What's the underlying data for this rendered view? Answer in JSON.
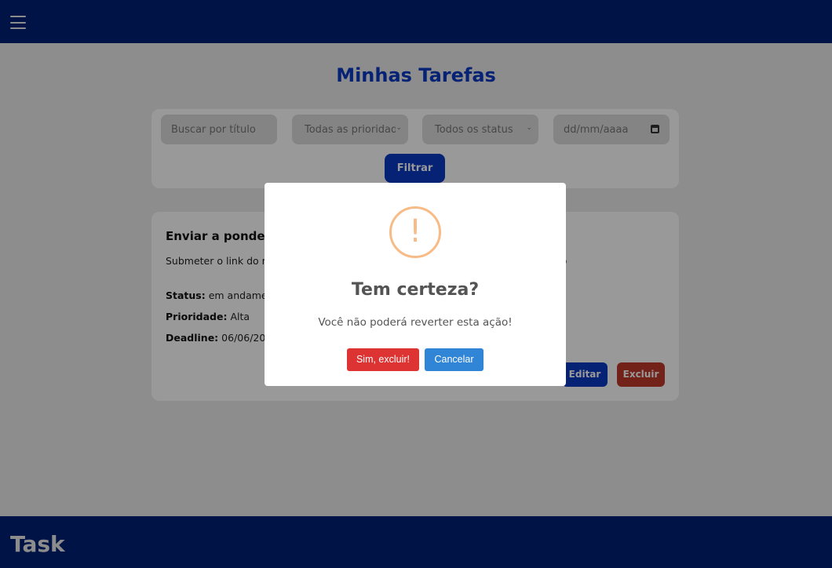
{
  "header": {
    "menu_icon": "hamburger-menu-icon"
  },
  "page": {
    "title": "Minhas Tarefas"
  },
  "filters": {
    "search_placeholder": "Buscar por título",
    "priority_selected": "Todas as prioridades",
    "status_selected": "Todos os status",
    "date_placeholder": "dd/mm/aaaa",
    "filter_button": "Filtrar"
  },
  "task": {
    "title": "Enviar a ponderação",
    "description": "Submeter o link do repositório do GitHub. Lembrar de deixar o repositório público",
    "status_label": "Status:",
    "status_value": "em andamento",
    "priority_label": "Prioridade:",
    "priority_value": "Alta",
    "deadline_label": "Deadline:",
    "deadline_value": "06/06/2025",
    "edit_button": "Editar",
    "delete_button": "Excluir"
  },
  "footer": {
    "brand": "Task"
  },
  "modal": {
    "icon": "!",
    "title": "Tem certeza?",
    "text": "Você não poderá reverter esta ação!",
    "confirm_button": "Sim, excluir!",
    "cancel_button": "Cancelar"
  },
  "colors": {
    "nav": "#002175",
    "accent": "#0a3ac4",
    "danger": "#dd3333",
    "cancel": "#3085d6",
    "warning": "#f8bb86"
  }
}
